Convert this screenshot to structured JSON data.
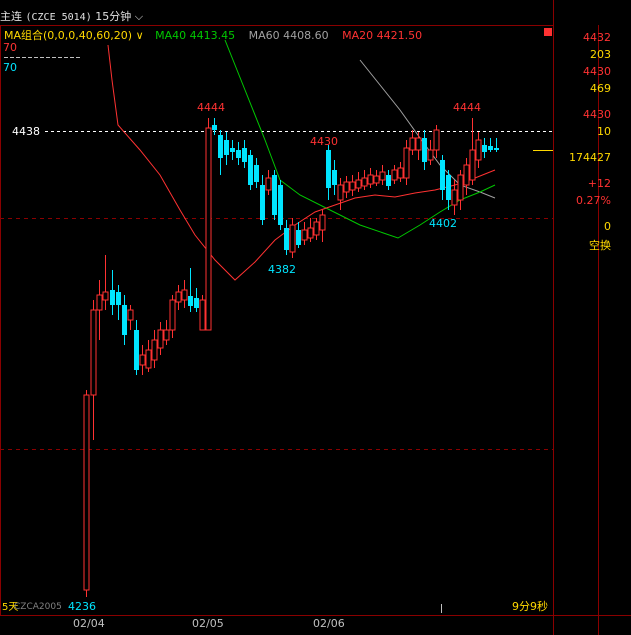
{
  "header": {
    "title": "主连",
    "code": "(CZCE 5014)",
    "period": "15分钟",
    "period_chevron": "chevron-down-icon"
  },
  "ma_legend": {
    "label": "MA组合(0,0,0,40,60,20)",
    "ma40": "MA40 4413.45",
    "ma60": "MA60 4408.60",
    "ma20": "MA20 4421.50",
    "chevron": "chevron-down-icon"
  },
  "left_axis": {
    "v1": "70",
    "v2": "70"
  },
  "annotations": {
    "high1": "4444",
    "high2": "4444",
    "mid_high": "4430",
    "low1": "4382",
    "low2": "4402",
    "min": "4236",
    "ref_price": "4438"
  },
  "right_panel": {
    "r1": "4432",
    "r2": "203",
    "r3": "4430",
    "r4": "469",
    "r5": "4430",
    "r6": "10",
    "r7": "174427",
    "r8": "+12",
    "r9": "0.27%",
    "r10": "0",
    "r11": "空换"
  },
  "footer": {
    "left_text": "5天",
    "left_code": "CZCA2005",
    "dates": [
      "02/04",
      "02/05",
      "02/06"
    ],
    "timer": "9分9秒"
  },
  "colors": {
    "up": "#ff3232",
    "down": "#00e5ff",
    "ma40": "#00c800",
    "ma60": "#a0a0a0",
    "ma20": "#ff3232",
    "yellow": "#ffd800"
  },
  "chart_data": {
    "type": "candlestick",
    "price_range": [
      4236,
      4444
    ],
    "reference_price": 4438,
    "labels_shown": {
      "max": 4444,
      "min": 4236
    }
  }
}
